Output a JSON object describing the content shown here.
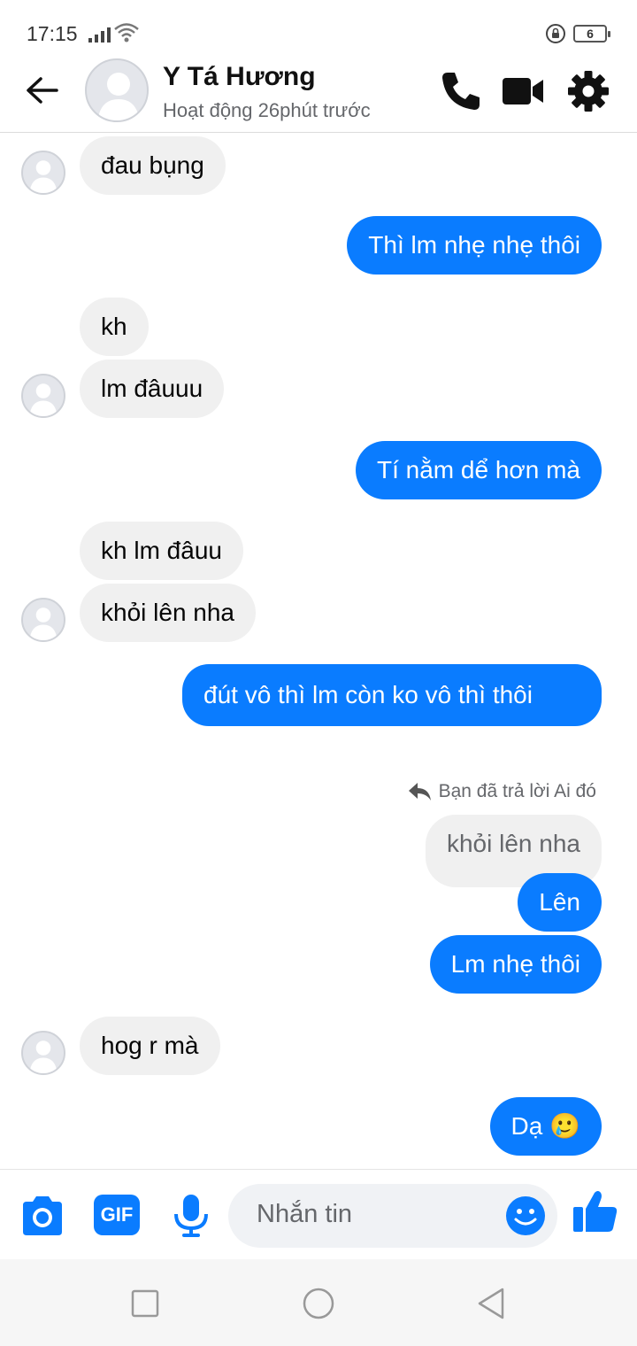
{
  "status_bar": {
    "time": "17:15",
    "battery": "6"
  },
  "header": {
    "name": "Y Tá Hương",
    "status": "Hoạt động 26phút trước",
    "icons": [
      "back-arrow-icon",
      "phone-icon",
      "video-camera-icon",
      "gear-icon"
    ]
  },
  "messages": [
    {
      "dir": "in",
      "text": "đau bụng"
    },
    {
      "dir": "out",
      "text": "Thì lm nhẹ nhẹ thôi"
    },
    {
      "dir": "in",
      "text": "kh"
    },
    {
      "dir": "in",
      "text": "lm đâuuu"
    },
    {
      "dir": "out",
      "text": "Tí nằm dể hơn mà"
    },
    {
      "dir": "in",
      "text": "kh lm đâuu"
    },
    {
      "dir": "in",
      "text": "khỏi lên nha"
    },
    {
      "dir": "out",
      "text": "đút vô thì lm còn ko vô thì thôi"
    },
    {
      "dir": "out",
      "text": "Lên"
    },
    {
      "dir": "out",
      "text": "Lm nhẹ thôi"
    },
    {
      "dir": "in",
      "text": "hog r mà"
    },
    {
      "dir": "out",
      "text": "Dạ",
      "emoji": "🥲"
    }
  ],
  "reply": {
    "label": "Bạn đã trả lời Ai đó",
    "quoted": "khỏi lên nha"
  },
  "composer": {
    "placeholder": "Nhắn tin",
    "gif_label": "GIF",
    "accent": "#0a7cff",
    "icons": [
      "camera-icon",
      "gif-icon",
      "microphone-icon",
      "emoji-icon",
      "thumbs-up-icon"
    ]
  },
  "colors": {
    "outgoing_bubble": "#0a7cff",
    "incoming_bubble": "#f0f0f0",
    "accent": "#0084ff"
  }
}
